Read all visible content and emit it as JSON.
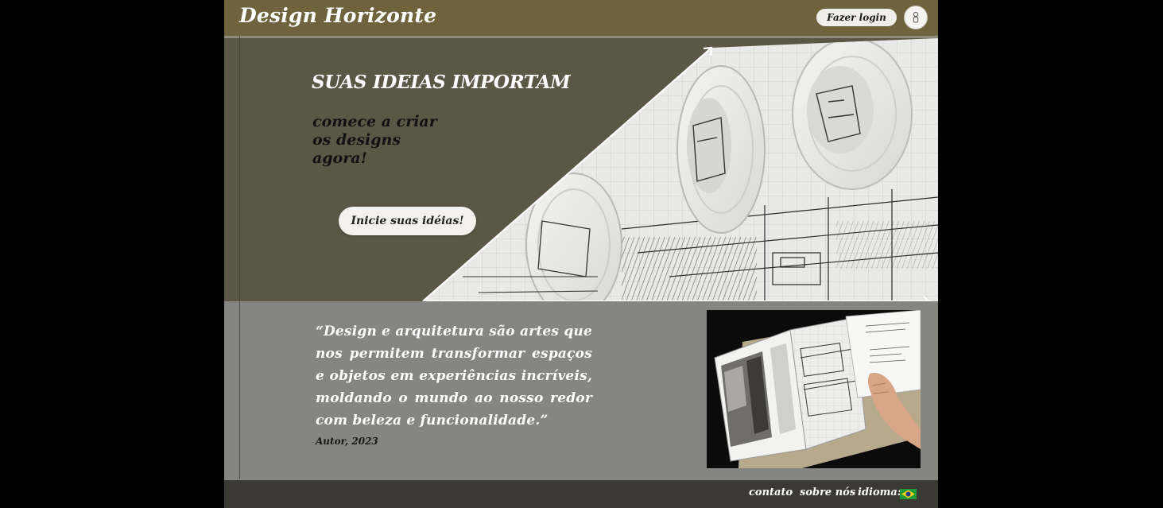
{
  "header": {
    "brand": "Design Horizonte",
    "login_label": "Fazer login",
    "user_icon": "user-icon"
  },
  "hero": {
    "title": "SUAS IDEIAS IMPORTAM",
    "subtitle_lines": [
      "comece a criar",
      "os designs",
      "agora!"
    ],
    "cta_label": "Inicie suas idéias!",
    "image": "rolled architectural blueprints photo",
    "arrow_icon": "arrow-up-right-icon"
  },
  "quote": {
    "text": "“Design e arquitetura são artes que nos permitem transformar espaços e objetos em experiências incríveis, moldando o mundo ao nosso redor com beleza e funcionalidade.”",
    "author": "Autor, 2023",
    "image": "hands holding architectural drawing booklet photo",
    "arrow_icon": "arrow-right-icon"
  },
  "footer": {
    "contact": "contato",
    "about": "sobre nós",
    "language_label": "idioma:",
    "flag_icon": "brazil-flag-icon"
  },
  "colors": {
    "header_bg": "#6f633e",
    "hero_bg": "#5b5747",
    "quote_bg": "#858582",
    "footer_bg": "#3b3934",
    "page_bg": "#000000"
  }
}
